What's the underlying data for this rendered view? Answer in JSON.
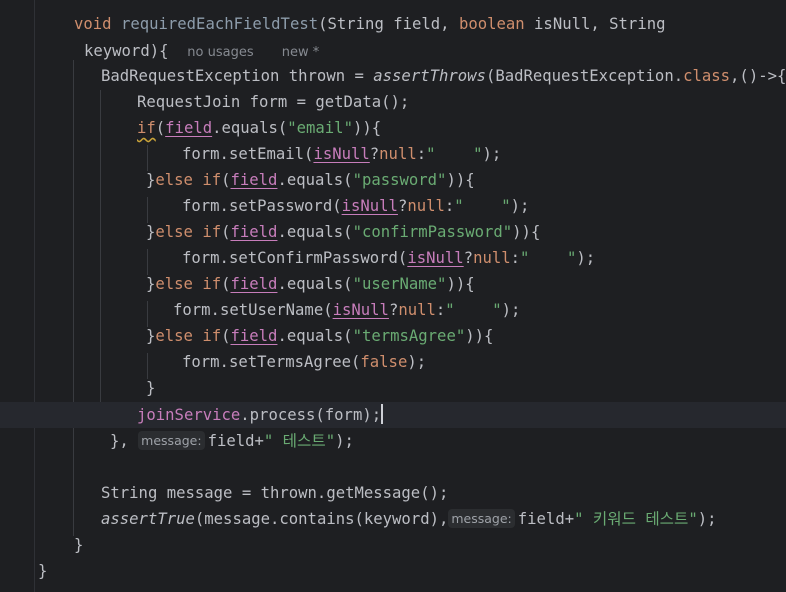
{
  "code": {
    "l1": {
      "kw_void": "void",
      "method_name": "requiredEachFieldTest",
      "p1": "(String field, ",
      "kw_boolean": "boolean",
      "p2": " isNull, String"
    },
    "l2": {
      "text": "keyword){",
      "usages_hint": "no usages",
      "new_hint": "new *"
    },
    "l3": {
      "a": "BadRequestException thrown = ",
      "assert_fn": "assertThrows",
      "b": "(BadRequestException.",
      "kw_class": "class",
      "c": ",()->{"
    },
    "l4": {
      "a": "RequestJoin form = getData();"
    },
    "l5": {
      "kw_if": "if",
      "open": "(",
      "field_var": "field",
      "equals": ".equals(",
      "str": "\"email\"",
      "close": ")){"
    },
    "l6": {
      "a": "form.setEmail(",
      "isnull_var": "isNull",
      "q": "?",
      "kw_null": "null",
      "colon": ":",
      "str": "\"    \"",
      "close": ");"
    },
    "l7": {
      "brace": "}",
      "kw_else_if": "else if",
      "open": "(",
      "field_var": "field",
      "equals": ".equals(",
      "str": "\"password\"",
      "close": ")){"
    },
    "l8": {
      "a": "form.setPassword(",
      "isnull_var": "isNull",
      "q": "?",
      "kw_null": "null",
      "colon": ":",
      "str": "\"    \"",
      "close": ");"
    },
    "l9": {
      "brace": "}",
      "kw_else_if": "else if",
      "open": "(",
      "field_var": "field",
      "equals": ".equals(",
      "str": "\"confirmPassword\"",
      "close": ")){"
    },
    "l10": {
      "a": "form.setConfirmPassword(",
      "isnull_var": "isNull",
      "q": "?",
      "kw_null": "null",
      "colon": ":",
      "str": "\"    \"",
      "close": ");"
    },
    "l11": {
      "brace": "}",
      "kw_else_if": "else if",
      "open": "(",
      "field_var": "field",
      "equals": ".equals(",
      "str": "\"userName\"",
      "close": ")){"
    },
    "l12": {
      "a": "form.setUserName(",
      "isnull_var": "isNull",
      "q": "?",
      "kw_null": "null",
      "colon": ":",
      "str": "\"    \"",
      "close": ");"
    },
    "l13": {
      "brace": "}",
      "kw_else_if": "else if",
      "open": "(",
      "field_var": "field",
      "equals": ".equals(",
      "str": "\"termsAgree\"",
      "close": ")){"
    },
    "l14": {
      "a": "form.setTermsAgree(",
      "kw_false": "false",
      "close": ");"
    },
    "l15": {
      "brace": "}"
    },
    "l16": {
      "service_var": "joinService",
      "dot": ".",
      "method": "process",
      "args": "(form);"
    },
    "l17": {
      "a": "},",
      "inlay": "message:",
      "b": "field+",
      "str": "\" 테스트\"",
      "close": ");"
    },
    "l19": {
      "a": "String message = thrown.getMessage();"
    },
    "l20": {
      "assert_fn": "assertTrue",
      "a": "(message.contains(keyword),",
      "inlay": "message:",
      "b": "field+",
      "str": "\" 키워드 테스트\"",
      "close": ");"
    },
    "l21": {
      "brace": "}"
    },
    "l22": {
      "brace": "}"
    }
  },
  "colors": {
    "background": "#1e1f22",
    "keyword": "#cf8e6d",
    "method_decl": "#56a8f5",
    "string": "#6aab73",
    "field": "#c77dbb",
    "plain": "#bcbec4"
  }
}
